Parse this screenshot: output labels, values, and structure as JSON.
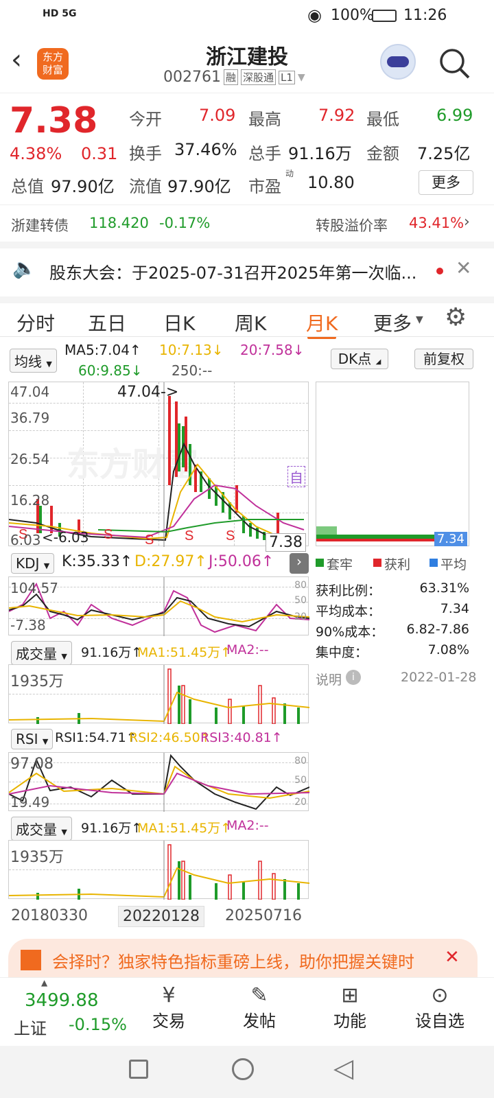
{
  "status": {
    "signal": "HD 5G",
    "battery": "100%",
    "time": "11:26"
  },
  "header": {
    "title": "浙江建投",
    "code": "002761",
    "tag1": "融",
    "tag2": "深股通",
    "tag3": "L1",
    "logo": "东方\n财富"
  },
  "quote": {
    "price": "7.38",
    "pct": "4.38%",
    "chg": "0.31",
    "open_label": "今开",
    "open": "7.09",
    "high_label": "最高",
    "high": "7.92",
    "low_label": "最低",
    "low": "6.99",
    "turnover_label": "换手",
    "turnover": "37.46%",
    "vol_label": "总手",
    "vol": "91.16万",
    "amt_label": "金额",
    "amt": "7.25亿",
    "mktcap_label": "总值",
    "mktcap": "97.90亿",
    "float_label": "流值",
    "float": "97.90亿",
    "pe_label": "市盈",
    "pe_sup": "动",
    "pe": "10.80",
    "more": "更多"
  },
  "bond": {
    "name": "浙建转债",
    "price": "118.420",
    "pct": "-0.17%",
    "premium_label": "转股溢价率",
    "premium": "43.41%"
  },
  "notice": {
    "text": "股东大会：于2025-07-31召开2025年第一次临..."
  },
  "tabs": [
    "分时",
    "五日",
    "日K",
    "周K",
    "月K",
    "更多"
  ],
  "active_tab": "月K",
  "ma": {
    "selector": "均线",
    "ma5": "MA5:7.04↑",
    "ma10": "10:7.13↓",
    "ma20": "20:7.58↓",
    "ma60": "60:9.85↓",
    "ma250": "250:--"
  },
  "main_axis": [
    "47.04",
    "36.79",
    "26.54",
    "16.28",
    "6.03"
  ],
  "main_labels": {
    "max": "47.04->",
    "min": "<-6.03",
    "last": "7.38",
    "watermark": "东方财富",
    "zi": "自"
  },
  "kdj": {
    "selector": "KDJ",
    "k": "K:35.33↑",
    "d": "D:27.97↑",
    "j": "J:50.06↑",
    "ymax": "104.57",
    "ymin": "-7.38",
    "lv": [
      "80",
      "50",
      "20"
    ]
  },
  "vol1": {
    "selector": "成交量",
    "v": "91.16万↑",
    "ma1": "MA1:51.45万↑",
    "ma2": "MA2:--",
    "ymax": "1935万"
  },
  "rsi": {
    "selector": "RSI",
    "r1": "RSI1:54.71↑",
    "r2": "RSI2:46.50↑",
    "r3": "RSI3:40.81↑",
    "ymax": "97.08",
    "ymin": "19.49",
    "lv": [
      "80",
      "50",
      "20"
    ]
  },
  "vol2": {
    "selector": "成交量",
    "v": "91.16万↑",
    "ma1": "MA1:51.45万↑",
    "ma2": "MA2:--",
    "ymax": "1935万"
  },
  "dates": [
    "20180330",
    "20220128",
    "20250716"
  ],
  "right": {
    "dk": "DK点",
    "fq": "前复权",
    "avg": "7.34",
    "leg1": "套牢",
    "leg2": "获利",
    "leg3": "平均",
    "rows": [
      [
        "获利比例：",
        "63.31%"
      ],
      [
        "平均成本：",
        "7.34"
      ],
      [
        "90%成本：",
        "6.82-7.86"
      ],
      [
        "集中度：",
        "7.08%"
      ]
    ],
    "note": "说明",
    "date": "2022-01-28"
  },
  "banner": {
    "text": "会择时？独家特色指标重磅上线，助你把握关键时"
  },
  "bottom": {
    "index_val": "3499.88",
    "index_name": "上证",
    "index_pct": "-0.15%",
    "b1": "交易",
    "b2": "发帖",
    "b3": "功能",
    "b4": "设自选"
  }
}
